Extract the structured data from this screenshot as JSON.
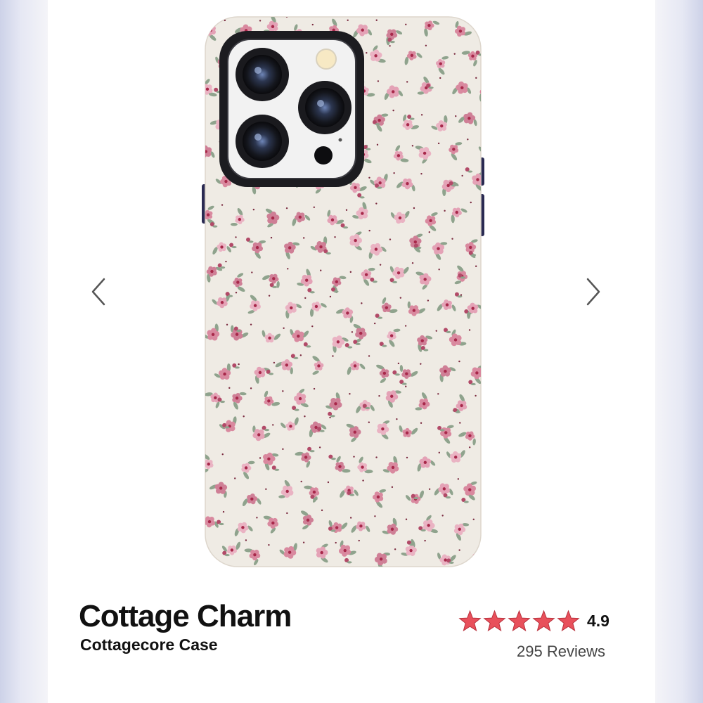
{
  "product": {
    "title": "Cottage Charm",
    "subtitle": "Cottagecore Case",
    "rating": 4.9,
    "rating_label": "4.9",
    "stars": 5,
    "reviews_label": "295 Reviews"
  },
  "carousel": {
    "prev_icon": "chevron-left-icon",
    "next_icon": "chevron-right-icon"
  },
  "colors": {
    "star": "#e8505b",
    "case_background": "#efebe4",
    "flower_pink": "#e4a2b6",
    "flower_center": "#a8284a",
    "leaf": "#8fa38d",
    "camera_frame": "#1c1c20",
    "camera_plate": "#f2f2f2"
  }
}
